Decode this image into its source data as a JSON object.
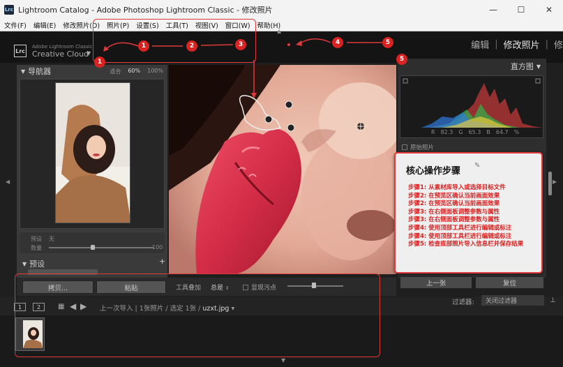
{
  "window": {
    "title": "Lightroom Catalog - Adobe Photoshop Lightroom Classic - 修改照片",
    "app_icon_label": "Lrc",
    "minimize_icon": "minimize-icon",
    "maximize_icon": "maximize-icon",
    "close_icon": "close-icon"
  },
  "menu": [
    "文件(F)",
    "编辑(E)",
    "修改照片(D)",
    "照片(P)",
    "设置(S)",
    "工具(T)",
    "视图(V)",
    "窗口(W)",
    "帮助(H)"
  ],
  "identity": {
    "logo": "Lrc",
    "brand_small": "Adobe Lightroom Classic",
    "brand_main": "Creative Cloud",
    "modules": [
      "编辑",
      "修改照片",
      "修"
    ],
    "active_module": "修改照片"
  },
  "navigator": {
    "title": "导航器",
    "zoom_options": [
      "适合",
      "60%",
      "100%"
    ],
    "selected_zoom": "60%"
  },
  "presets_area": {
    "preset_label": "预设",
    "preset_value": "无",
    "amount_label": "数量",
    "amount_value": "100",
    "presets_title": "预设"
  },
  "histogram": {
    "title": "直方图",
    "r_label": "R",
    "r_value": "82.3",
    "g_label": "G",
    "g_value": "65.3",
    "b_label": "B",
    "b_value": "64.7",
    "unit": "%",
    "original_label": "原始照片"
  },
  "callout": {
    "title": "核心操作步骤",
    "steps": [
      "步骤1: 从素材库导入或选择目标文件",
      "步骤2: 在预览区确认当前画面效果",
      "步骤2: 在预览区确认当前画面效果",
      "步骤3: 在右侧面板调整参数与属性",
      "步骤3: 在右侧面板调整参数与属性",
      "步骤4: 使用顶部工具栏进行编辑或标注",
      "步骤4: 使用顶部工具栏进行编辑或标注",
      "步骤5: 检查底部照片导入信息栏并保存结果"
    ]
  },
  "toolbar": {
    "copy_label": "拷贝...",
    "paste_label": "粘贴",
    "tool_overlay_label": "工具叠加",
    "tool_overlay_value": "总是",
    "spot_label": "显现污点",
    "prev_label": "上一张",
    "reset_label": "复位"
  },
  "filmstrip": {
    "page1": "1",
    "page2": "2",
    "path_prefix": "上一次导入",
    "count_text": "1张照片 / 选定 1张 /",
    "filename": "uzxt.jpg",
    "filter_label": "过滤器:",
    "filter_value": "关闭过滤器"
  },
  "annotations": {
    "markers": [
      "1",
      "1",
      "2",
      "3",
      "4",
      "5",
      "5"
    ],
    "color": "#e0393a"
  },
  "colors": {
    "accent_red": "#e0393a",
    "panel_bg": "#3a3a3a",
    "lip_red": "#d9374e"
  }
}
